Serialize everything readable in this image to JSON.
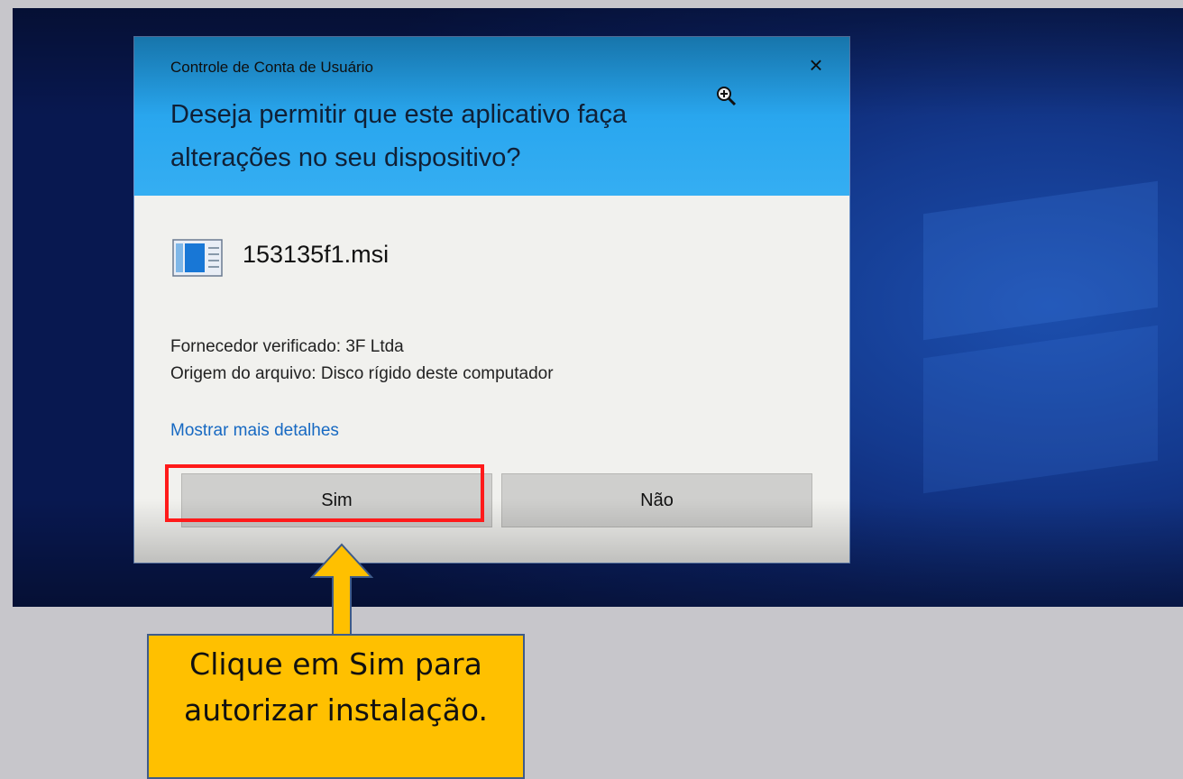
{
  "dialog": {
    "title": "Controle de Conta de Usuário",
    "question": "Deseja permitir que este aplicativo faça alterações no seu dispositivo?",
    "file_name": "153135f1.msi",
    "publisher": "Fornecedor verificado: 3F Ltda",
    "origin": "Origem do arquivo: Disco rígido deste computador",
    "details_link": "Mostrar mais detalhes",
    "yes_label": "Sim",
    "no_label": "Não",
    "close_symbol": "×",
    "icons": {
      "close": "close-icon",
      "file": "installer-file-icon",
      "zoom": "zoom-in-cursor-icon"
    }
  },
  "annotation": {
    "callout_text": "Clique em Sim para autorizar instalação.",
    "highlight_color": "#ff1a1a",
    "callout_color": "#ffc000"
  },
  "colors": {
    "header": "#2aa7ef",
    "desktop": "#143a8f",
    "link": "#1769c2"
  }
}
